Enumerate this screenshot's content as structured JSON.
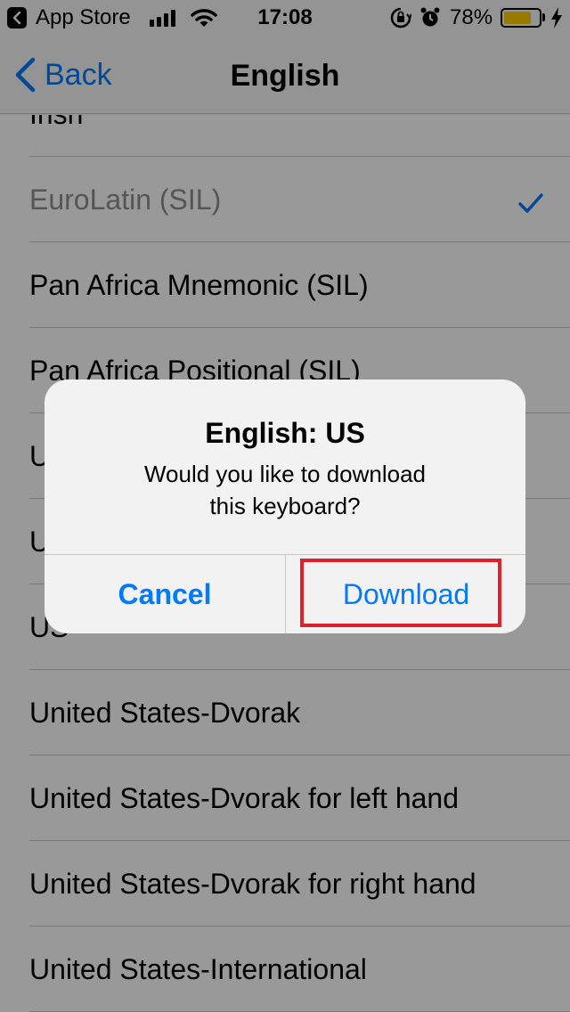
{
  "status_bar": {
    "back_app": "App Store",
    "time": "17:08",
    "battery_pct": "78%",
    "battery_level": 0.78,
    "battery_color": "#ffcc00"
  },
  "nav": {
    "back_label": "Back",
    "title": "English"
  },
  "list": {
    "items": [
      {
        "label": "Irish",
        "selected": false
      },
      {
        "label": "EuroLatin (SIL)",
        "selected": true
      },
      {
        "label": "Pan Africa Mnemonic (SIL)",
        "selected": false
      },
      {
        "label": "Pan Africa Positional (SIL)",
        "selected": false
      },
      {
        "label": "U",
        "selected": false
      },
      {
        "label": "U",
        "selected": false
      },
      {
        "label": "US",
        "selected": false
      },
      {
        "label": "United States-Dvorak",
        "selected": false
      },
      {
        "label": "United States-Dvorak for left hand",
        "selected": false
      },
      {
        "label": "United States-Dvorak for right hand",
        "selected": false
      },
      {
        "label": "United States-International",
        "selected": false
      }
    ]
  },
  "alert": {
    "title": "English: US",
    "message": "Would you like to download this keyboard?",
    "cancel_label": "Cancel",
    "download_label": "Download"
  },
  "colors": {
    "accent": "#007aff",
    "highlight": "#e0202a"
  }
}
